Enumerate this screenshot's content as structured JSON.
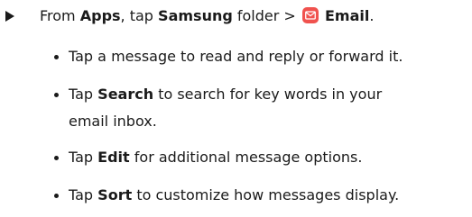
{
  "step": {
    "prefix": "From ",
    "apps": "Apps",
    "mid": ", tap ",
    "samsung": "Samsung",
    "folder": " folder > ",
    "email": "Email",
    "end": ".",
    "icon": "email-app-icon"
  },
  "bullets": [
    {
      "pre": "Tap a message to read and reply or forward it.",
      "bold": "",
      "post": ""
    },
    {
      "pre": "Tap ",
      "bold": "Search",
      "post": " to search for key words in your",
      "line2": "email inbox."
    },
    {
      "pre": "Tap ",
      "bold": "Edit",
      "post": " for additional message options."
    },
    {
      "pre": "Tap ",
      "bold": "Sort",
      "post": " to customize how messages display."
    }
  ],
  "colors": {
    "text": "#1a1a1a",
    "email_icon": "#f0524e"
  }
}
